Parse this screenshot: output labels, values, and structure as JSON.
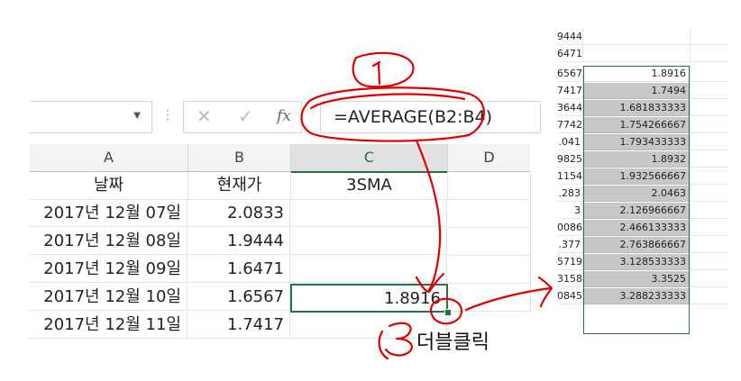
{
  "formula_bar": {
    "cancel_glyph": "✕",
    "enter_glyph": "✓",
    "fx_label": "fx",
    "formula": "=AVERAGE(B2:B4)"
  },
  "grid": {
    "columns": [
      "A",
      "B",
      "C",
      "D"
    ],
    "selected_column": "C",
    "header_row": [
      "날짜",
      "현재가",
      "3SMA"
    ],
    "rows": [
      {
        "date": "2017년 12월 07일",
        "price": "2.0833",
        "sma": ""
      },
      {
        "date": "2017년 12월 08일",
        "price": "1.9444",
        "sma": ""
      },
      {
        "date": "2017년 12월 09일",
        "price": "1.6471",
        "sma": ""
      },
      {
        "date": "2017년 12월 10일",
        "price": "1.6567",
        "sma": "1.8916"
      },
      {
        "date": "2017년 12월 11일",
        "price": "1.7417",
        "sma": ""
      }
    ]
  },
  "right_panel": {
    "rows": [
      {
        "left": "9444",
        "value": ""
      },
      {
        "left": "6471",
        "value": ""
      },
      {
        "left": "6567",
        "value": "1.8916"
      },
      {
        "left": "7417",
        "value": "1.7494"
      },
      {
        "left": "3644",
        "value": "1.681833333"
      },
      {
        "left": "7742",
        "value": "1.754266667"
      },
      {
        "left": ".041",
        "value": "1.793433333"
      },
      {
        "left": "9825",
        "value": "1.8932"
      },
      {
        "left": "1154",
        "value": "1.932566667"
      },
      {
        "left": ".283",
        "value": "2.0463"
      },
      {
        "left": "3",
        "value": "2.126966667"
      },
      {
        "left": "0086",
        "value": "2.466133333"
      },
      {
        "left": ".377",
        "value": "2.763866667"
      },
      {
        "left": "5719",
        "value": "3.128533333"
      },
      {
        "left": "3158",
        "value": "3.3525"
      },
      {
        "left": "0845",
        "value": "3.288233333"
      }
    ]
  },
  "annotations": {
    "note": "더블클릭",
    "stroke_color": "#e00000"
  },
  "colors": {
    "excel_green": "#217346",
    "fill_gray": "#c8c8c8"
  }
}
